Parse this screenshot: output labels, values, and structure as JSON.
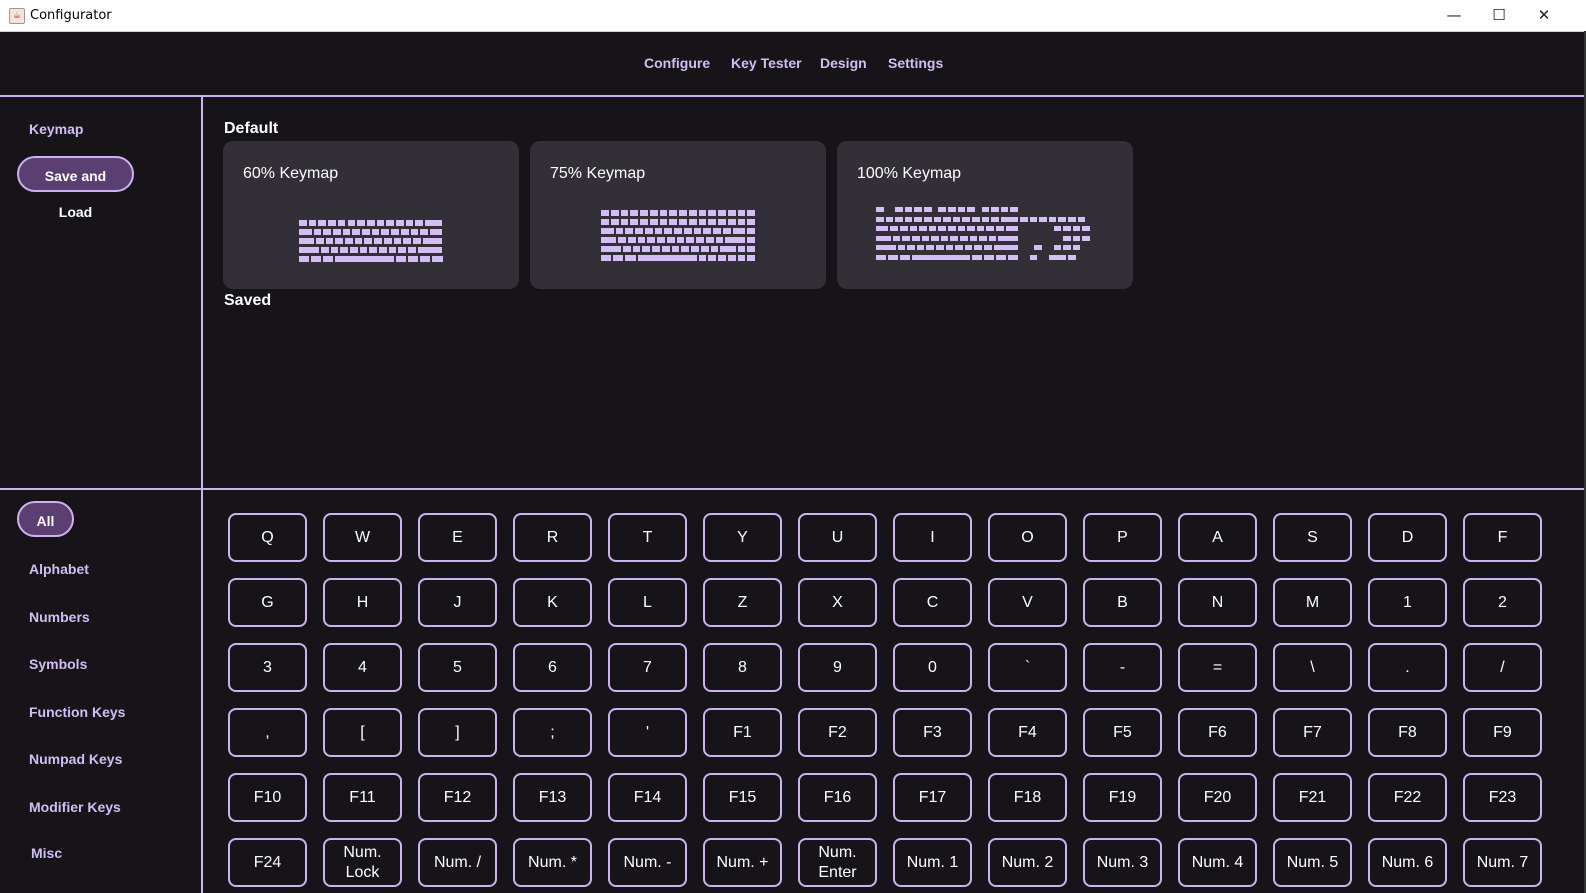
{
  "window": {
    "title": "Configurator",
    "controls": {
      "minimize": "—",
      "maximize": "☐",
      "close": "✕"
    }
  },
  "nav": {
    "items": [
      "Configure",
      "Key Tester",
      "Design",
      "Settings"
    ]
  },
  "sidebar_top": {
    "items": [
      "Keymap",
      "Save and Load"
    ],
    "selected": "Save and Load"
  },
  "main": {
    "default_label": "Default",
    "saved_label": "Saved",
    "cards": [
      {
        "title": "60% Keymap"
      },
      {
        "title": "75% Keymap"
      },
      {
        "title": "100% Keymap"
      }
    ]
  },
  "categories": {
    "items": [
      "All",
      "Alphabet",
      "Numbers",
      "Symbols",
      "Function Keys",
      "Numpad Keys",
      "Modifier Keys",
      "Misc"
    ],
    "selected": "All"
  },
  "keys": [
    "Q",
    "W",
    "E",
    "R",
    "T",
    "Y",
    "U",
    "I",
    "O",
    "P",
    "A",
    "S",
    "D",
    "F",
    "G",
    "H",
    "J",
    "K",
    "L",
    "Z",
    "X",
    "C",
    "V",
    "B",
    "N",
    "M",
    "1",
    "2",
    "3",
    "4",
    "5",
    "6",
    "7",
    "8",
    "9",
    "0",
    "`",
    "-",
    "=",
    "\\",
    ".",
    "/",
    ",",
    "[",
    "]",
    ";",
    "'",
    "F1",
    "F2",
    "F3",
    "F4",
    "F5",
    "F6",
    "F7",
    "F8",
    "F9",
    "F10",
    "F11",
    "F12",
    "F13",
    "F14",
    "F15",
    "F16",
    "F17",
    "F18",
    "F19",
    "F20",
    "F21",
    "F22",
    "F23",
    "F24",
    "Num. Lock",
    "Num. /",
    "Num. *",
    "Num. -",
    "Num. +",
    "Num. Enter",
    "Num. 1",
    "Num. 2",
    "Num. 3",
    "Num. 4",
    "Num. 5",
    "Num. 6",
    "Num. 7"
  ],
  "colors": {
    "accent": "#cbb3ef",
    "background": "#161418",
    "card": "#332f37",
    "pill": "#5b3f73"
  }
}
